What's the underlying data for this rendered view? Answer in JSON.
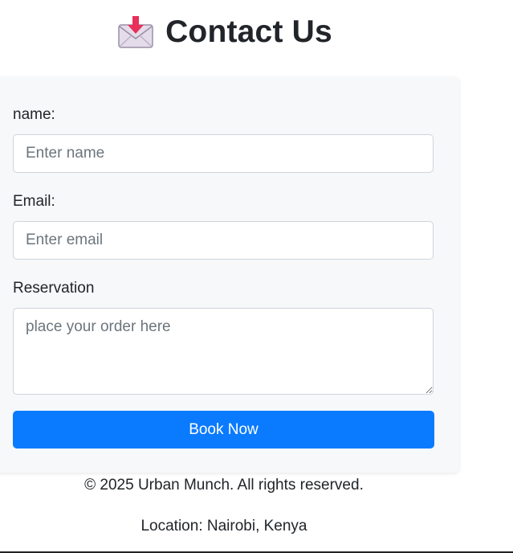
{
  "header": {
    "title": "Contact Us",
    "icon": "inbox-tray-envelope-icon"
  },
  "form": {
    "name_label": "name:",
    "name_placeholder": "Enter name",
    "email_label": "Email:",
    "email_placeholder": "Enter email",
    "reservation_label": "Reservation",
    "reservation_placeholder": "place your order here",
    "submit_label": "Book Now"
  },
  "footer": {
    "copyright": "© 2025 Urban Munch. All rights reserved.",
    "location": "Location: Nairobi, Kenya"
  },
  "colors": {
    "primary": "#0a7bff",
    "card_bg": "#f7f8fa",
    "icon_arrow": "#e8305a"
  }
}
